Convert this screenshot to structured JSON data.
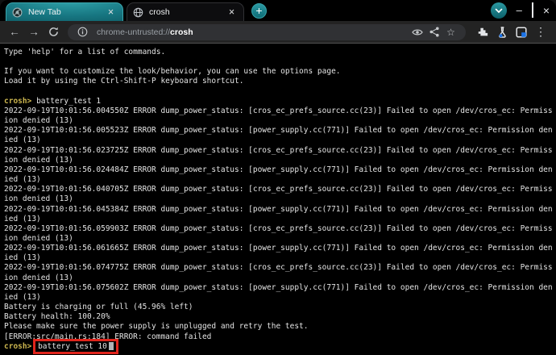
{
  "window": {
    "tabs": [
      {
        "title": "New Tab",
        "active": true,
        "favicon": "chromium-icon"
      },
      {
        "title": "crosh",
        "active": false,
        "favicon": "globe-icon"
      }
    ],
    "new_tab_button_glyph": "+",
    "controls": {
      "minimize_glyph": "–",
      "close_glyph": "×"
    }
  },
  "toolbar": {
    "glyphs": {
      "back": "←",
      "forward": "→",
      "star": "☆",
      "menu": "⋮"
    },
    "url": {
      "scheme": "chrome-untrusted://",
      "host": "crosh"
    },
    "icons": [
      "back-icon",
      "forward-icon",
      "reload-icon",
      "info-icon",
      "eye-icon",
      "share-icon",
      "star-icon",
      "extensions-icon",
      "experiments-flask-icon",
      "profile-icon",
      "menu-icon"
    ]
  },
  "colors": {
    "accent_teal": "#1b828c",
    "terminal_background": "#000000",
    "prompt_yellow": "#cdb74f",
    "annotation_red": "#e0241b",
    "experiment_blue": "#1a73e8"
  },
  "terminal": {
    "prompt_label": "crosh>",
    "lines": [
      {
        "type": "text",
        "text": "Type 'help' for a list of commands."
      },
      {
        "type": "blank"
      },
      {
        "type": "text",
        "text": "If you want to customize the look/behavior, you can use the options page."
      },
      {
        "type": "text",
        "text": "Load it by using the Ctrl-Shift-P keyboard shortcut."
      },
      {
        "type": "blank"
      },
      {
        "type": "prompt",
        "command": "battery_test 1"
      },
      {
        "type": "text",
        "text": "2022-09-19T10:01:56.004550Z ERROR dump_power_status: [cros_ec_prefs_source.cc(23)] Failed to open /dev/cros_ec: Permiss"
      },
      {
        "type": "text",
        "text": "ion denied (13)"
      },
      {
        "type": "text",
        "text": "2022-09-19T10:01:56.005523Z ERROR dump_power_status: [power_supply.cc(771)] Failed to open /dev/cros_ec: Permission den"
      },
      {
        "type": "text",
        "text": "ied (13)"
      },
      {
        "type": "text",
        "text": "2022-09-19T10:01:56.023725Z ERROR dump_power_status: [cros_ec_prefs_source.cc(23)] Failed to open /dev/cros_ec: Permiss"
      },
      {
        "type": "text",
        "text": "ion denied (13)"
      },
      {
        "type": "text",
        "text": "2022-09-19T10:01:56.024484Z ERROR dump_power_status: [power_supply.cc(771)] Failed to open /dev/cros_ec: Permission den"
      },
      {
        "type": "text",
        "text": "ied (13)"
      },
      {
        "type": "text",
        "text": "2022-09-19T10:01:56.040705Z ERROR dump_power_status: [cros_ec_prefs_source.cc(23)] Failed to open /dev/cros_ec: Permiss"
      },
      {
        "type": "text",
        "text": "ion denied (13)"
      },
      {
        "type": "text",
        "text": "2022-09-19T10:01:56.045384Z ERROR dump_power_status: [power_supply.cc(771)] Failed to open /dev/cros_ec: Permission den"
      },
      {
        "type": "text",
        "text": "ied (13)"
      },
      {
        "type": "text",
        "text": "2022-09-19T10:01:56.059903Z ERROR dump_power_status: [cros_ec_prefs_source.cc(23)] Failed to open /dev/cros_ec: Permiss"
      },
      {
        "type": "text",
        "text": "ion denied (13)"
      },
      {
        "type": "text",
        "text": "2022-09-19T10:01:56.061665Z ERROR dump_power_status: [power_supply.cc(771)] Failed to open /dev/cros_ec: Permission den"
      },
      {
        "type": "text",
        "text": "ied (13)"
      },
      {
        "type": "text",
        "text": "2022-09-19T10:01:56.074775Z ERROR dump_power_status: [cros_ec_prefs_source.cc(23)] Failed to open /dev/cros_ec: Permiss"
      },
      {
        "type": "text",
        "text": "ion denied (13)"
      },
      {
        "type": "text",
        "text": "2022-09-19T10:01:56.075602Z ERROR dump_power_status: [power_supply.cc(771)] Failed to open /dev/cros_ec: Permission den"
      },
      {
        "type": "text",
        "text": "ied (13)"
      },
      {
        "type": "text",
        "text": "Battery is charging or full (45.96% left)"
      },
      {
        "type": "text",
        "text": "Battery health: 100.20%"
      },
      {
        "type": "text",
        "text": "Please make sure the power supply is unplugged and retry the test."
      },
      {
        "type": "text",
        "text": "[ERROR:src/main.rs:184] ERROR: command failed"
      },
      {
        "type": "prompt",
        "command": "battery_test 10",
        "highlight": true,
        "cursor": true
      }
    ]
  }
}
